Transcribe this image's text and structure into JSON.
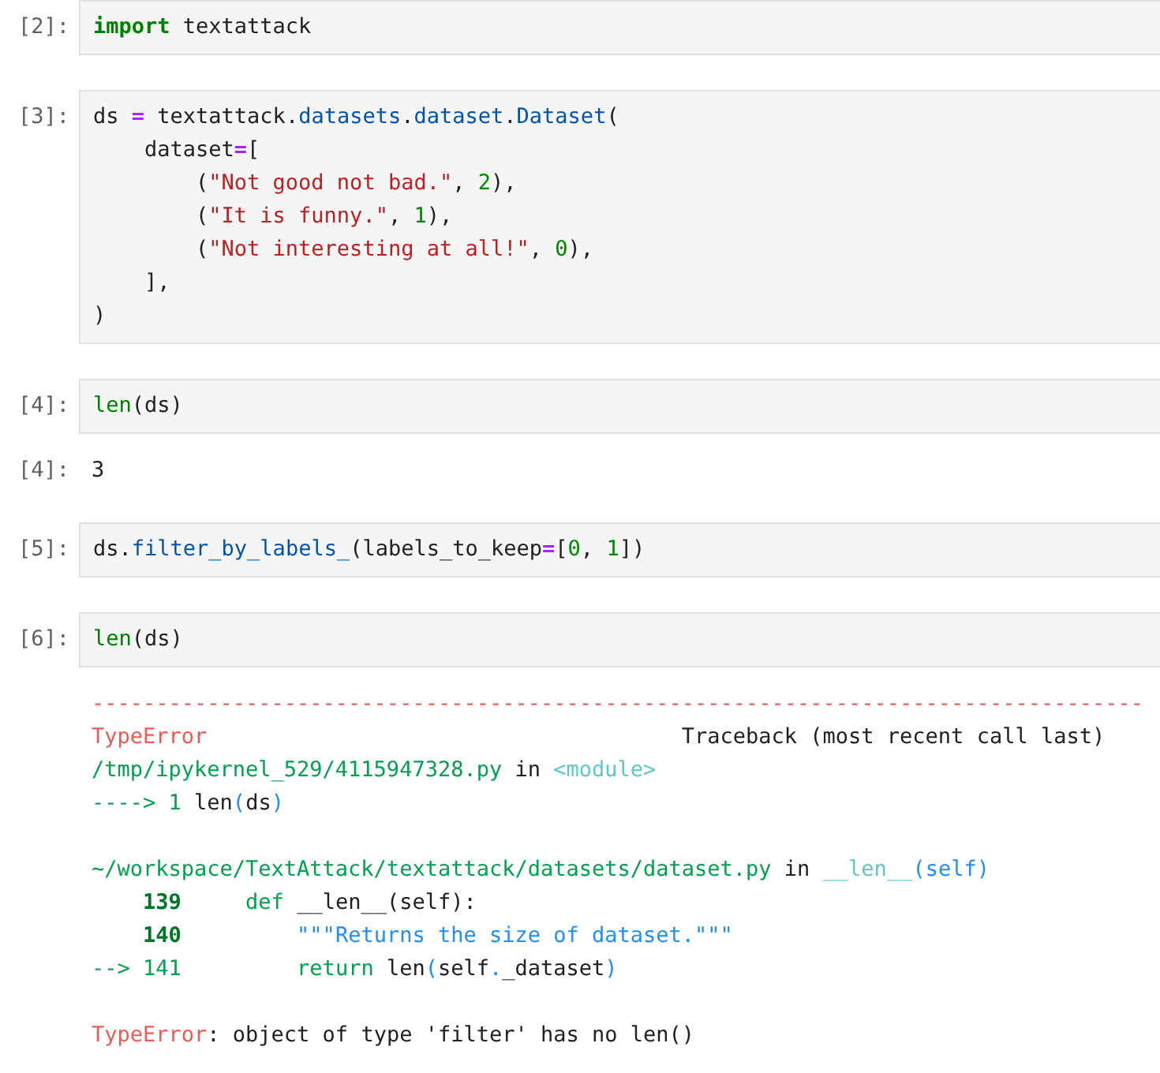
{
  "cells": [
    {
      "kind": "input",
      "prompt": "[2]:",
      "lines": [
        [
          {
            "t": "import",
            "kind": "kw"
          },
          {
            "t": " textattack",
            "kind": "p"
          }
        ]
      ]
    },
    {
      "kind": "input",
      "prompt": "[3]:",
      "lines": [
        [
          {
            "t": "ds ",
            "kind": "p"
          },
          {
            "t": "=",
            "kind": "op"
          },
          {
            "t": " textattack",
            "kind": "p"
          },
          {
            "t": ".",
            "kind": "p"
          },
          {
            "t": "datasets",
            "kind": "attr"
          },
          {
            "t": ".",
            "kind": "p"
          },
          {
            "t": "dataset",
            "kind": "attr"
          },
          {
            "t": ".",
            "kind": "p"
          },
          {
            "t": "Dataset",
            "kind": "attr"
          },
          {
            "t": "(",
            "kind": "p"
          }
        ],
        [
          {
            "t": "    dataset",
            "kind": "p"
          },
          {
            "t": "=",
            "kind": "op"
          },
          {
            "t": "[",
            "kind": "p"
          }
        ],
        [
          {
            "t": "        (",
            "kind": "p"
          },
          {
            "t": "\"Not good not bad.\"",
            "kind": "str"
          },
          {
            "t": ", ",
            "kind": "p"
          },
          {
            "t": "2",
            "kind": "num"
          },
          {
            "t": "),",
            "kind": "p"
          }
        ],
        [
          {
            "t": "        (",
            "kind": "p"
          },
          {
            "t": "\"It is funny.\"",
            "kind": "str"
          },
          {
            "t": ", ",
            "kind": "p"
          },
          {
            "t": "1",
            "kind": "num"
          },
          {
            "t": "),",
            "kind": "p"
          }
        ],
        [
          {
            "t": "        (",
            "kind": "p"
          },
          {
            "t": "\"Not interesting at all!\"",
            "kind": "str"
          },
          {
            "t": ", ",
            "kind": "p"
          },
          {
            "t": "0",
            "kind": "num"
          },
          {
            "t": "),",
            "kind": "p"
          }
        ],
        [
          {
            "t": "    ],",
            "kind": "p"
          }
        ],
        [
          {
            "t": ")",
            "kind": "p"
          }
        ]
      ]
    },
    {
      "kind": "input",
      "prompt": "[4]:",
      "lines": [
        [
          {
            "t": "len",
            "kind": "builtin"
          },
          {
            "t": "(ds)",
            "kind": "p"
          }
        ]
      ]
    },
    {
      "kind": "output",
      "prompt": "[4]:",
      "lines": [
        [
          {
            "t": "3",
            "kind": "p"
          }
        ]
      ]
    },
    {
      "kind": "input",
      "prompt": "[5]:",
      "lines": [
        [
          {
            "t": "ds",
            "kind": "p"
          },
          {
            "t": ".",
            "kind": "p"
          },
          {
            "t": "filter_by_labels_",
            "kind": "attr"
          },
          {
            "t": "(labels_to_keep",
            "kind": "p"
          },
          {
            "t": "=",
            "kind": "op"
          },
          {
            "t": "[",
            "kind": "p"
          },
          {
            "t": "0",
            "kind": "num"
          },
          {
            "t": ", ",
            "kind": "p"
          },
          {
            "t": "1",
            "kind": "num"
          },
          {
            "t": "])",
            "kind": "p"
          }
        ]
      ]
    },
    {
      "kind": "input",
      "prompt": "[6]:",
      "lines": [
        [
          {
            "t": "len",
            "kind": "builtin"
          },
          {
            "t": "(ds)",
            "kind": "p"
          }
        ]
      ]
    },
    {
      "kind": "error",
      "blocks": [
        [
          [
            {
              "t": "----------------------------------------------------------------------------------",
              "kind": "ered"
            }
          ],
          [
            {
              "t": "TypeError",
              "kind": "ered"
            },
            {
              "t": "                                     Traceback (most recent call last)",
              "kind": "p"
            }
          ],
          [
            {
              "t": "/tmp/ipykernel_529/4115947328.py",
              "kind": "egreen"
            },
            {
              "t": " in ",
              "kind": "p"
            },
            {
              "t": "<module>",
              "kind": "ecyan"
            }
          ],
          [
            {
              "t": "----> 1 ",
              "kind": "egreen"
            },
            {
              "t": "len",
              "kind": "p"
            },
            {
              "t": "(",
              "kind": "eblue"
            },
            {
              "t": "ds",
              "kind": "p"
            },
            {
              "t": ")",
              "kind": "eblue"
            }
          ]
        ],
        [
          [
            {
              "t": "~/workspace/TextAttack/textattack/datasets/dataset.py",
              "kind": "egreen"
            },
            {
              "t": " in ",
              "kind": "p"
            },
            {
              "t": "__len__",
              "kind": "ecyan"
            },
            {
              "t": "(self)",
              "kind": "eblue"
            }
          ],
          [
            {
              "t": "    139",
              "kind": "elineno"
            },
            {
              "t": "     def",
              "kind": "egreen"
            },
            {
              "t": " __len__(self):",
              "kind": "p"
            }
          ],
          [
            {
              "t": "    140",
              "kind": "elineno"
            },
            {
              "t": "         \"\"\"Returns the size of dataset.\"\"\"",
              "kind": "eblue"
            }
          ],
          [
            {
              "t": "--> 141",
              "kind": "egreen"
            },
            {
              "t": "         return",
              "kind": "egreen"
            },
            {
              "t": " len",
              "kind": "p"
            },
            {
              "t": "(",
              "kind": "eblue"
            },
            {
              "t": "self",
              "kind": "p"
            },
            {
              "t": ".",
              "kind": "eblue"
            },
            {
              "t": "_dataset",
              "kind": "p"
            },
            {
              "t": ")",
              "kind": "eblue"
            }
          ]
        ],
        [
          [
            {
              "t": "TypeError",
              "kind": "ered"
            },
            {
              "t": ": object of type 'filter' has no len()",
              "kind": "p"
            }
          ]
        ]
      ]
    }
  ]
}
